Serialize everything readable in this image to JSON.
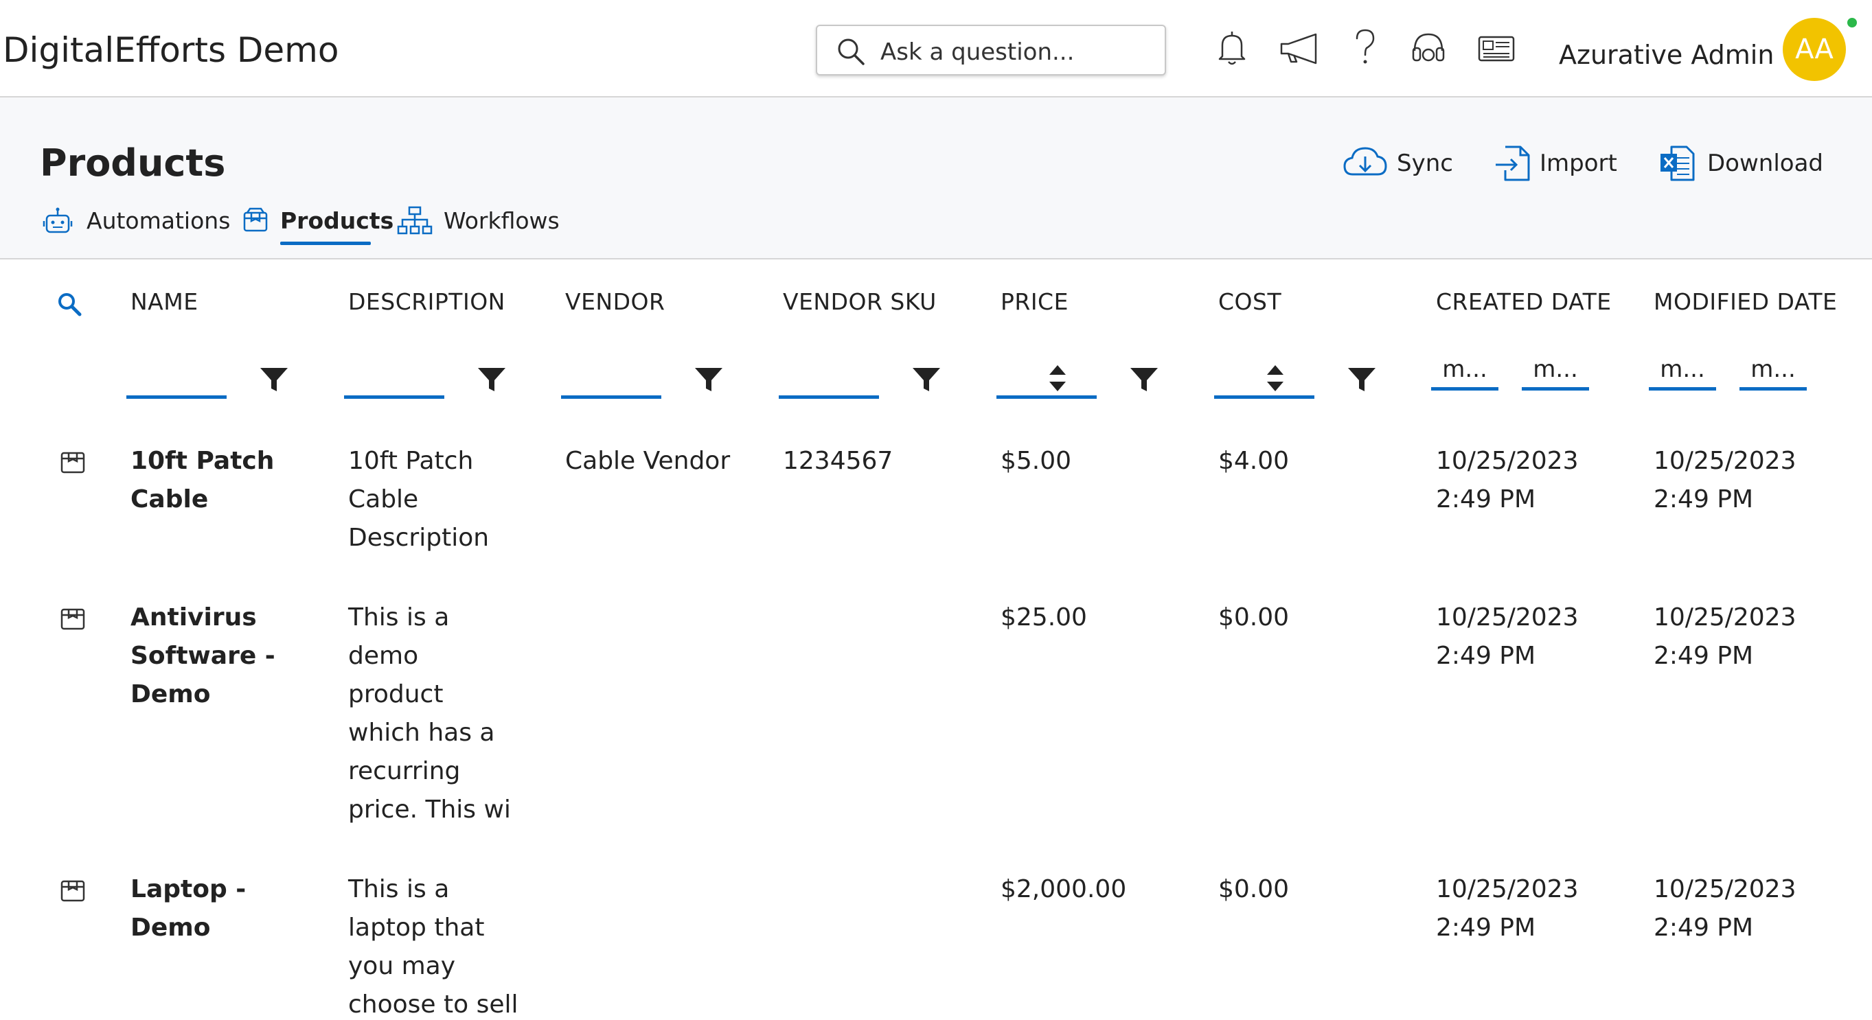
{
  "app": {
    "title": "DigitalEfforts Demo"
  },
  "search": {
    "placeholder": "Ask a question..."
  },
  "topbar": {
    "icons": [
      "bell-icon",
      "megaphone-icon",
      "help-icon",
      "headset-icon",
      "news-icon"
    ],
    "user_name": "Azurative Admin",
    "avatar_initials": "AA",
    "avatar_color": "#f2c300",
    "presence_color": "#2bb84a"
  },
  "page": {
    "title": "Products"
  },
  "actions": {
    "sync": "Sync",
    "import": "Import",
    "download": "Download"
  },
  "tabs": [
    {
      "label": "Automations",
      "icon": "robot-icon",
      "active": false
    },
    {
      "label": "Products",
      "icon": "product-box-icon",
      "active": true
    },
    {
      "label": "Workflows",
      "icon": "workflow-icon",
      "active": false
    }
  ],
  "columns": {
    "name": "NAME",
    "description": "DESCRIPTION",
    "vendor": "VENDOR",
    "vendor_sku": "VENDOR SKU",
    "price": "PRICE",
    "cost": "COST",
    "created": "CREATED DATE",
    "modified": "MODIFIED DATE"
  },
  "date_filters": {
    "placeholder": "m..."
  },
  "rows": [
    {
      "name_lines": [
        "10ft Patch",
        "Cable"
      ],
      "desc_lines": [
        "10ft Patch",
        "Cable",
        "Description"
      ],
      "vendor": "Cable Vendor",
      "sku": "1234567",
      "price": "$5.00",
      "cost": "$4.00",
      "created_lines": [
        "10/25/2023",
        "2:49 PM"
      ],
      "modified_lines": [
        "10/25/2023",
        "2:49 PM"
      ]
    },
    {
      "name_lines": [
        "Antivirus",
        "Software -",
        "Demo"
      ],
      "desc_lines": [
        "This is a",
        "demo",
        "product",
        "which has a",
        "recurring",
        "price. This wi"
      ],
      "vendor": "",
      "sku": "",
      "price": "$25.00",
      "cost": "$0.00",
      "created_lines": [
        "10/25/2023",
        "2:49 PM"
      ],
      "modified_lines": [
        "10/25/2023",
        "2:49 PM"
      ]
    },
    {
      "name_lines": [
        "Laptop -",
        "Demo"
      ],
      "desc_lines": [
        "This is a",
        "laptop that",
        "you may",
        "choose to sell"
      ],
      "vendor": "",
      "sku": "",
      "price": "$2,000.00",
      "cost": "$0.00",
      "created_lines": [
        "10/25/2023",
        "2:49 PM"
      ],
      "modified_lines": [
        "10/25/2023",
        "2:49 PM"
      ]
    }
  ],
  "accent_color": "#0b6cc4"
}
